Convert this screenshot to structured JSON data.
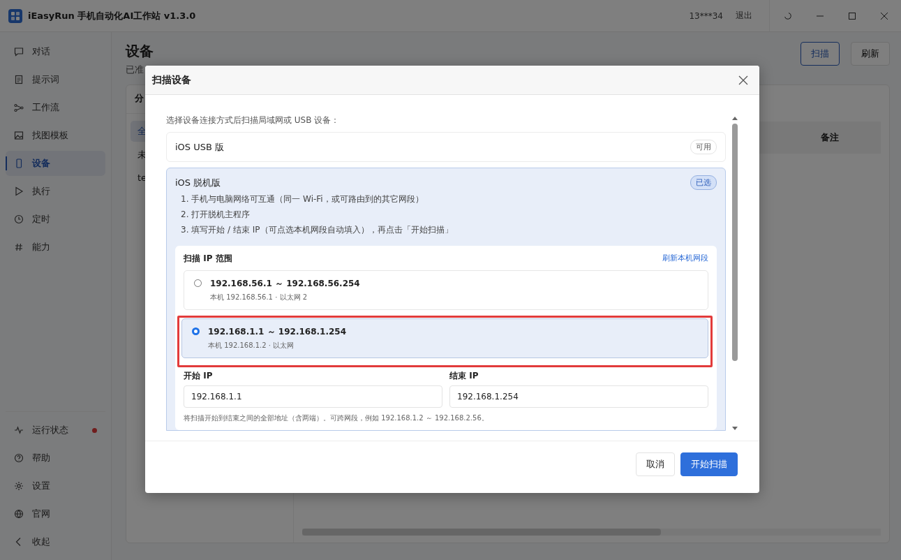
{
  "window": {
    "title": "iEasyRun 手机自动化AI工作站 v1.3.0",
    "user": "13***34",
    "logout": "退出"
  },
  "sidebar": {
    "items": [
      {
        "label": "对话",
        "selected": false
      },
      {
        "label": "提示词",
        "selected": false
      },
      {
        "label": "工作流",
        "selected": false
      },
      {
        "label": "找图模板",
        "selected": false
      },
      {
        "label": "设备",
        "selected": true
      },
      {
        "label": "执行",
        "selected": false
      },
      {
        "label": "定时",
        "selected": false
      },
      {
        "label": "能力",
        "selected": false
      }
    ],
    "bottom_items": [
      {
        "label": "运行状态",
        "alert": true
      },
      {
        "label": "帮助",
        "alert": false
      },
      {
        "label": "设置",
        "alert": false
      },
      {
        "label": "官网",
        "alert": false
      },
      {
        "label": "收起",
        "alert": false
      }
    ]
  },
  "page": {
    "title": "设备",
    "subtitle": "已准",
    "buttons": [
      {
        "label": "扫描",
        "kind": "primary"
      },
      {
        "label": "刷新",
        "kind": "plain"
      }
    ],
    "groups_header": "分",
    "groups": [
      {
        "label": "全",
        "selected": true
      },
      {
        "label": "未",
        "selected": false
      },
      {
        "label": "te",
        "selected": false
      }
    ],
    "table": {
      "columns": [
        "备注"
      ]
    }
  },
  "dialog": {
    "title": "扫描设备",
    "intro": "选择设备连接方式后扫描局域网或 USB 设备：",
    "options": [
      {
        "name": "iOS USB 版",
        "badge": "可用",
        "selected": false
      },
      {
        "name": "iOS 脱机版",
        "badge": "已选",
        "selected": true,
        "steps": [
          "1. 手机与电脑网络可互通（同一 Wi-Fi，或可路由到的其它网段）",
          "2. 打开脱机主程序",
          "3. 填写开始 / 结束 IP（可点选本机网段自动填入），再点击「开始扫描」"
        ]
      }
    ],
    "ip_range": {
      "title": "扫描 IP 范围",
      "refresh": "刷新本机网段",
      "ranges": [
        {
          "range": "192.168.56.1 ～ 192.168.56.254",
          "detail": "本机 192.168.56.1 · 以太网 2",
          "selected": false
        },
        {
          "range": "192.168.1.1 ～ 192.168.1.254",
          "detail": "本机 192.168.1.2 · 以太网",
          "selected": true
        }
      ],
      "start_label": "开始 IP",
      "start_value": "192.168.1.1",
      "end_label": "结束 IP",
      "end_value": "192.168.1.254",
      "hint": "将扫描开始到结束之间的全部地址（含两端）。可跨网段，例如 192.168.1.2 ～ 192.168.2.56。"
    },
    "buttons": [
      {
        "label": "取消",
        "kind": "plain"
      },
      {
        "label": "开始扫描",
        "kind": "primary"
      }
    ]
  }
}
